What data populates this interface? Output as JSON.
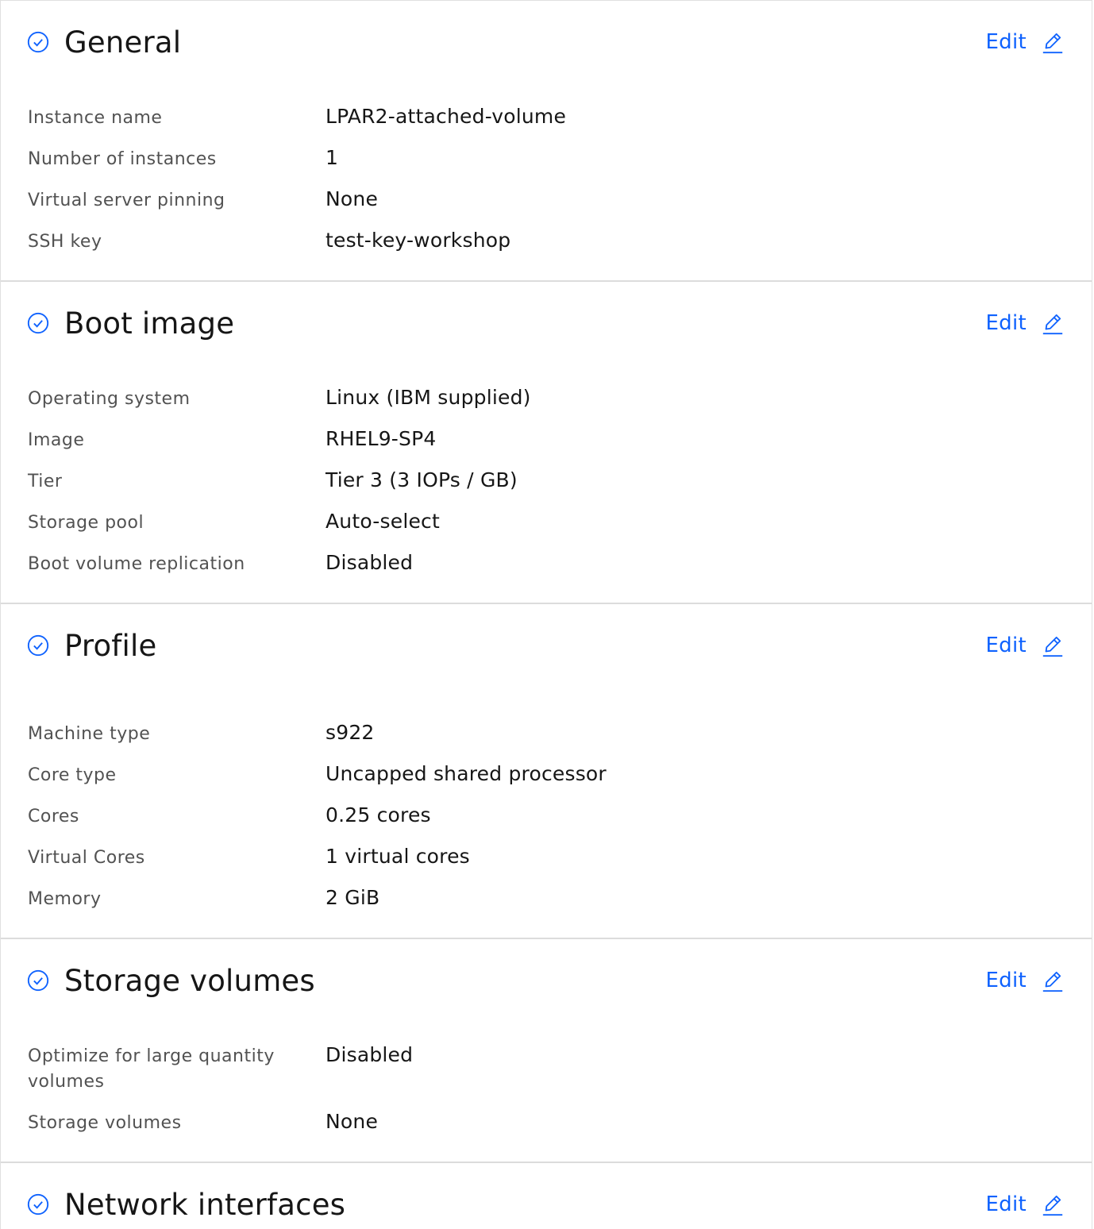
{
  "edit_label": "Edit",
  "accent_color": "#0f62fe",
  "sections": [
    {
      "title": "General",
      "rows": [
        {
          "label": "Instance name",
          "value": "LPAR2-attached-volume"
        },
        {
          "label": "Number of instances",
          "value": "1"
        },
        {
          "label": "Virtual server pinning",
          "value": "None"
        },
        {
          "label": "SSH key",
          "value": "test-key-workshop"
        }
      ]
    },
    {
      "title": "Boot image",
      "rows": [
        {
          "label": "Operating system",
          "value": "Linux (IBM supplied)"
        },
        {
          "label": "Image",
          "value": "RHEL9-SP4"
        },
        {
          "label": "Tier",
          "value": "Tier 3 (3 IOPs / GB)"
        },
        {
          "label": "Storage pool",
          "value": "Auto-select"
        },
        {
          "label": "Boot volume replication",
          "value": "Disabled"
        }
      ]
    },
    {
      "title": "Profile",
      "rows": [
        {
          "label": "Machine type",
          "value": "s922"
        },
        {
          "label": "Core type",
          "value": "Uncapped shared processor"
        },
        {
          "label": "Cores",
          "value": "0.25 cores"
        },
        {
          "label": "Virtual Cores",
          "value": "1 virtual cores"
        },
        {
          "label": "Memory",
          "value": "2 GiB"
        }
      ]
    },
    {
      "title": "Storage volumes",
      "rows": [
        {
          "label": "Optimize for large quantity volumes",
          "value": "Disabled"
        },
        {
          "label": "Storage volumes",
          "value": "None"
        }
      ]
    },
    {
      "title": "Network interfaces",
      "rows": []
    }
  ]
}
